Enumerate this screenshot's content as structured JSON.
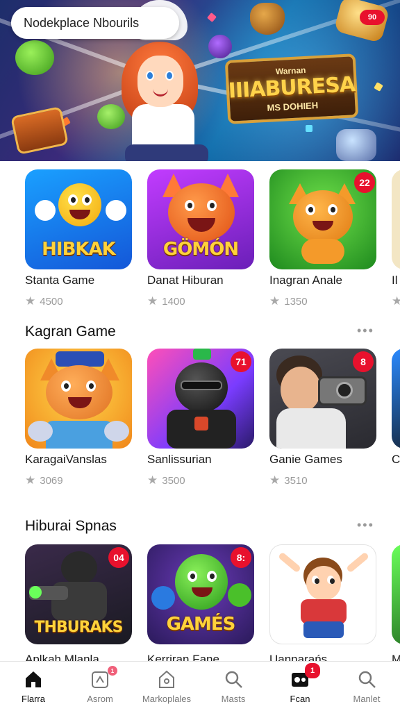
{
  "hero": {
    "search_text": "Nodekplace Nbourils",
    "badge_text": "90",
    "logo_title": "IIIABURESA",
    "logo_top": "Warnan",
    "logo_sub": "MS DOHIEH"
  },
  "sections": [
    {
      "title": "",
      "cards": [
        {
          "name": "Stanta Game",
          "rating": "4500",
          "art_word": "HIBKAK",
          "badge": ""
        },
        {
          "name": "Danat Hiburan",
          "rating": "1400",
          "art_word": "GÖMÓN",
          "badge": ""
        },
        {
          "name": "Inagran Anale",
          "rating": "1350",
          "art_word": "",
          "badge": "22"
        },
        {
          "name": "Il",
          "rating": "",
          "art_word": "",
          "badge": ""
        }
      ]
    },
    {
      "title": "Kagran Game",
      "more": "•••",
      "cards": [
        {
          "name": "KaragaiVanslas",
          "rating": "3069",
          "art_word": "",
          "badge": ""
        },
        {
          "name": "Sanlissurian",
          "rating": "3500",
          "art_word": "",
          "badge": "71"
        },
        {
          "name": "Ganie Games",
          "rating": "3510",
          "art_word": "",
          "badge": "8"
        },
        {
          "name": "C",
          "rating": "",
          "art_word": "",
          "badge": ""
        }
      ]
    },
    {
      "title": "Hiburai Spnas",
      "more": "•••",
      "cards": [
        {
          "name": "Aplkah Mlanla",
          "rating": "",
          "art_word": "THBURAKS",
          "badge": "04"
        },
        {
          "name": "Kerriran Fane",
          "rating": "",
          "art_word": "GAMÉS",
          "badge": "8:"
        },
        {
          "name": "Uannarańs",
          "rating": "",
          "art_word": "",
          "badge": ""
        },
        {
          "name": "M",
          "rating": "",
          "art_word": "",
          "badge": ""
        }
      ]
    }
  ],
  "nav": [
    {
      "label": "Flarra",
      "icon": "home-icon",
      "badge": ""
    },
    {
      "label": "Asrom",
      "icon": "game-icon",
      "badge": "1"
    },
    {
      "label": "Markoplales",
      "icon": "store-icon",
      "badge": ""
    },
    {
      "label": "Masts",
      "icon": "search-icon",
      "badge": ""
    },
    {
      "label": "Fcan",
      "icon": "games-tile-icon",
      "badge": "1"
    },
    {
      "label": "Manlet",
      "icon": "search-icon",
      "badge": ""
    }
  ],
  "colors": {
    "accent": "#e8112d",
    "nav_active": "#111111",
    "muted": "#9a9a9a"
  }
}
